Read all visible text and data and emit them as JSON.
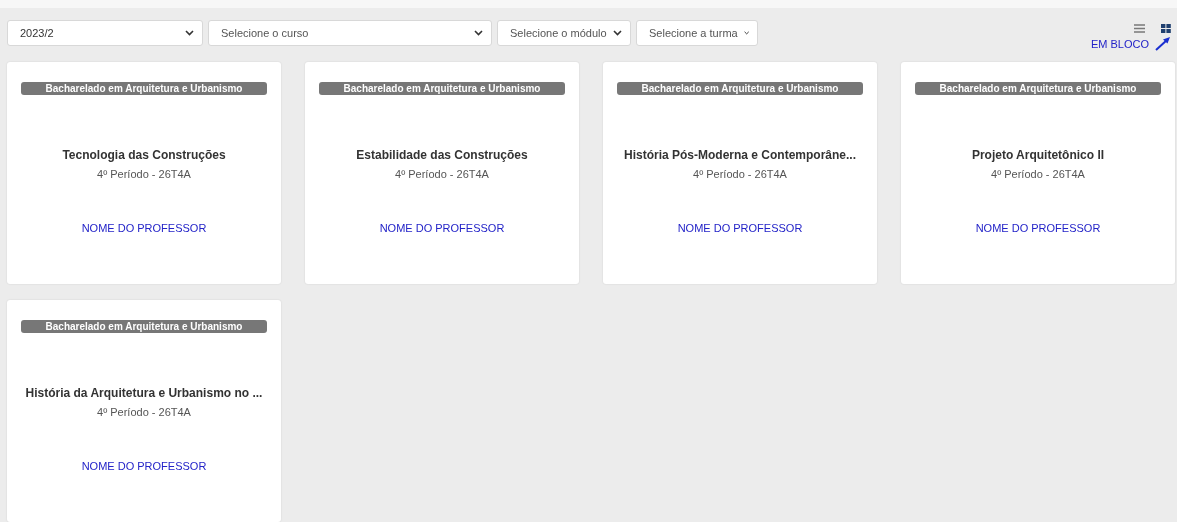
{
  "filters": [
    {
      "text": "2023/2",
      "kind": "value"
    },
    {
      "text": "Selecione o curso",
      "kind": "placeholder"
    },
    {
      "text": "Selecione o módulo",
      "kind": "placeholder"
    },
    {
      "text": "Selecione a turma",
      "kind": "placeholder"
    }
  ],
  "view_toggles": [
    {
      "kind": "list",
      "selected": false
    },
    {
      "kind": "grid",
      "selected": true
    }
  ],
  "annotation": {
    "text": "EM BLOCO"
  },
  "cards": [
    {
      "course": "Bacharelado em Arquitetura e Urbanismo",
      "title": "Tecnologia das Construções",
      "period": "4º Período - 26T4A",
      "teacher": "NOME DO PROFESSOR"
    },
    {
      "course": "Bacharelado em Arquitetura e Urbanismo",
      "title": "Estabilidade das Construções",
      "period": "4º Período - 26T4A",
      "teacher": "NOME DO PROFESSOR"
    },
    {
      "course": "Bacharelado em Arquitetura e Urbanismo",
      "title": "História Pós-Moderna e Contemporâne...",
      "period": "4º Período - 26T4A",
      "teacher": "NOME DO PROFESSOR"
    },
    {
      "course": "Bacharelado em Arquitetura e Urbanismo",
      "title": "Projeto Arquitetônico II",
      "period": "4º Período - 26T4A",
      "teacher": "NOME DO PROFESSOR"
    },
    {
      "course": "Bacharelado em Arquitetura e Urbanismo",
      "title": "História da Arquitetura e Urbanismo no ...",
      "period": "4º Período - 26T4A",
      "teacher": "NOME DO PROFESSOR"
    }
  ]
}
